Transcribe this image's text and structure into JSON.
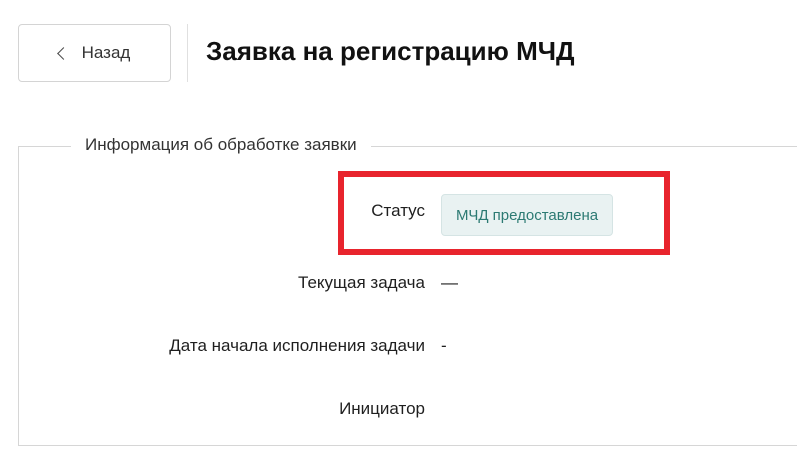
{
  "header": {
    "back_label": "Назад",
    "title": "Заявка на регистрацию МЧД"
  },
  "panel": {
    "legend": "Информация об обработке заявки",
    "fields": [
      {
        "label": "Статус",
        "value": "МЧД предоставлена"
      },
      {
        "label": "Текущая задача",
        "value": "—"
      },
      {
        "label": "Дата начала исполнения задачи",
        "value": "-"
      },
      {
        "label": "Инициатор",
        "value": ""
      }
    ]
  },
  "colors": {
    "highlight": "#e8242d",
    "status_text": "#2c7a73",
    "status_bg": "#e9f2f2"
  }
}
